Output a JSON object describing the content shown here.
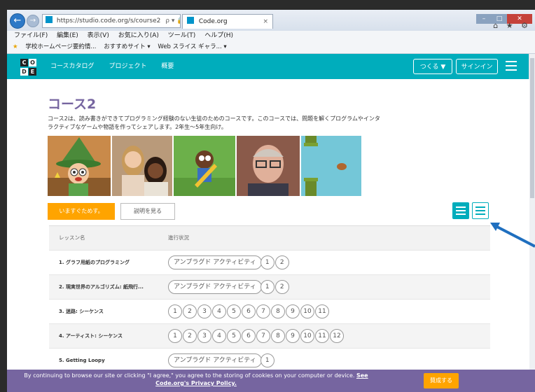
{
  "browser": {
    "address": "https://studio.code.org/s/course2",
    "address_icons": "ρ ▾ 🔒 C",
    "tab_title": "Code.org",
    "tab_close": "×",
    "menu": [
      "ファイル(F)",
      "編集(E)",
      "表示(V)",
      "お気に入り(A)",
      "ツール(T)",
      "ヘルプ(H)"
    ],
    "favorites": [
      "学校ホームページ要約情...",
      "おすすめサイト ▾",
      "Web スライス ギャラ... ▾"
    ],
    "toolbar_icons": "⌂ ★ ⚙"
  },
  "header": {
    "logo_letters": [
      "C",
      "O",
      "D",
      "E"
    ],
    "nav": [
      "コースカタログ",
      "プロジェクト",
      "概要"
    ],
    "create_label": "つくる ▼",
    "signin_label": "サインイン"
  },
  "course": {
    "title": "コース2",
    "description": "コース2は、読み書きができてプログラミング経験のない生徒のためのコースです。このコースでは、問題を解くプログラムやインタラクティブなゲームや物語を作ってシェアします。2年生〜5年生向け。",
    "start_button": "いますぐためす。",
    "details_button": "説明を見る"
  },
  "table": {
    "col_lesson": "レッスン名",
    "col_progress": "進行状況",
    "rows": [
      {
        "name": "1. グラフ用紙のプログラミング",
        "unplugged": "アンプラグド アクティビティ",
        "levels": [
          "1",
          "2"
        ]
      },
      {
        "name": "2. 現実世界のアルゴリズム: 紙飛行...",
        "unplugged": "アンプラグド アクティビティ",
        "levels": [
          "1",
          "2"
        ]
      },
      {
        "name": "3. 迷路: シーケンス",
        "unplugged": "",
        "levels": [
          "1",
          "2",
          "3",
          "4",
          "5",
          "6",
          "7",
          "8",
          "9",
          "10",
          "11"
        ]
      },
      {
        "name": "4. アーティスト: シーケンス",
        "unplugged": "",
        "levels": [
          "1",
          "2",
          "3",
          "4",
          "5",
          "6",
          "7",
          "8",
          "9",
          "10",
          "11",
          "12"
        ]
      },
      {
        "name": "5. Getting Loopy",
        "unplugged": "アンプラグド アクティビティ",
        "levels": [
          "1"
        ]
      }
    ]
  },
  "cookie": {
    "text": "By continuing to browse our site or clicking \"I agree,\" you agree to the storing of cookies on your computer or device.",
    "link": "See Code.org's Privacy Policy.",
    "agree": "賛成する"
  },
  "colors": {
    "brand_teal": "#00adbc",
    "purple": "#7665a0",
    "orange": "#ffa400",
    "annotation_arrow": "#1f6fbf"
  }
}
